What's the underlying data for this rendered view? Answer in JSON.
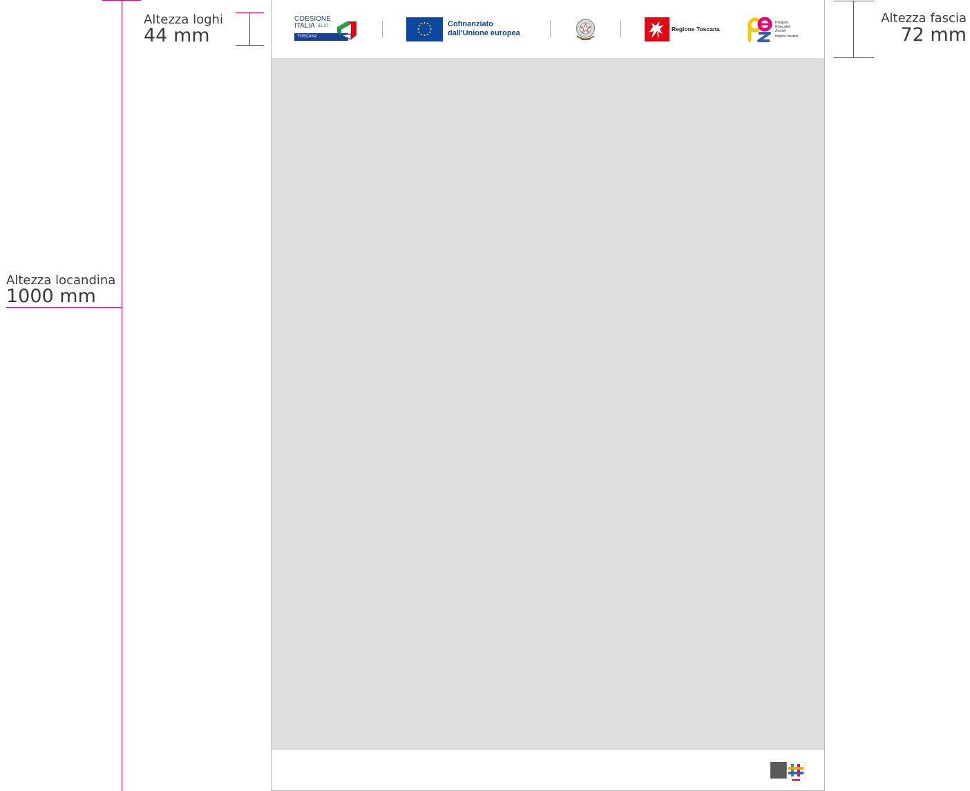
{
  "measures": {
    "locandina": {
      "label": "Altezza locandina",
      "value": "1000 mm"
    },
    "loghi": {
      "label": "Altezza loghi",
      "value": "44 mm"
    },
    "fascia": {
      "label": "Altezza fascia",
      "value": "72 mm"
    }
  },
  "logos": {
    "coesione": {
      "line1": "COESIONE",
      "line2": "ITALIA",
      "years": "21-27",
      "region": "TOSCANA"
    },
    "eu": {
      "line1": "Cofinanziato",
      "line2": "dall'Unione europea"
    },
    "emblem": {
      "icon": "italian-republic-emblem-icon"
    },
    "toscana": {
      "name": "Regione Toscana"
    },
    "pez": {
      "line1": "Progetti",
      "line2": "Educativi",
      "line3": "Zonali",
      "line4": "Regione Toscana"
    }
  },
  "colors": {
    "measure_line": "#e6007e",
    "placeholder": "#dfdfdf",
    "eu_blue": "#0e47a1",
    "coesione_blue": "#1d3f8f",
    "toscana_red": "#e30613"
  }
}
